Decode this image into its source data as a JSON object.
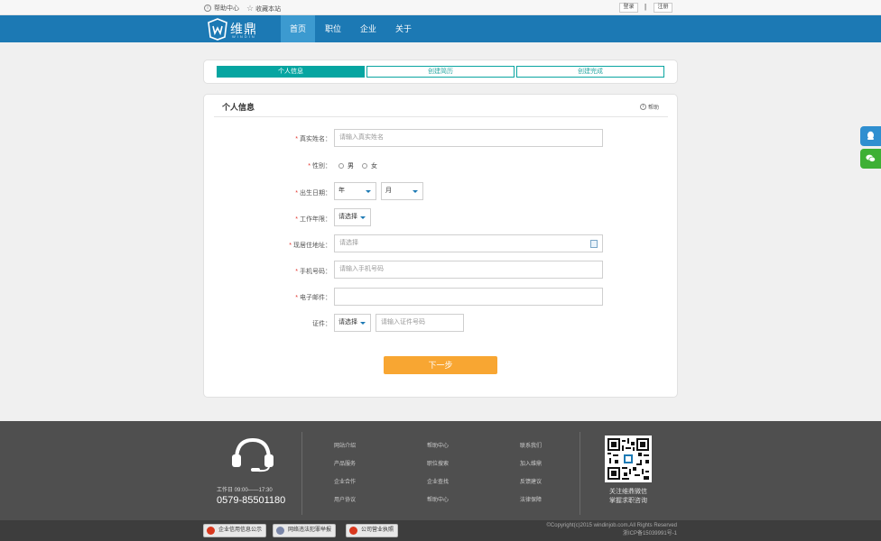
{
  "topbar": {
    "help_center": "帮助中心",
    "bookmark": "收藏本站",
    "login": "登录",
    "separator": "|",
    "register": "注册"
  },
  "nav": {
    "logo_text": "维鼎",
    "logo_sub": "WINDIN",
    "items": [
      "首页",
      "职位",
      "企业",
      "关于"
    ],
    "active_index": 0
  },
  "steps": [
    "个人信息",
    "创建简历",
    "创建完成"
  ],
  "form": {
    "title": "个人信息",
    "help": "帮助",
    "fields": {
      "name": {
        "label": "真实姓名：",
        "placeholder": "请输入真实姓名"
      },
      "gender": {
        "label": "性别：",
        "options": [
          "男",
          "女"
        ]
      },
      "birth": {
        "label": "出生日期：",
        "year": "年",
        "month": "月"
      },
      "work_years": {
        "label": "工作年限：",
        "value": "请选择"
      },
      "address": {
        "label": "现居住地址：",
        "placeholder": "请选择"
      },
      "phone": {
        "label": "手机号码：",
        "placeholder": "请输入手机号码"
      },
      "email": {
        "label": "电子邮件：",
        "placeholder": ""
      },
      "id_doc": {
        "label": "证件：",
        "type_value": "请选择",
        "placeholder": "请输入证件号码"
      }
    },
    "required_mark": "*",
    "next_button": "下一步"
  },
  "footer": {
    "work_time": "工作日  09:00——17:30",
    "phone": "0579-85501180",
    "links": [
      [
        "网站介绍",
        "产品服务",
        "企业合作",
        "用户协议"
      ],
      [
        "帮助中心",
        "职位搜索",
        "企业查找",
        "帮助中心"
      ],
      [
        "联系我们",
        "加入维鼎",
        "反馈建议",
        "法律保障"
      ]
    ],
    "qr_text_1": "关注维鼎微信",
    "qr_text_2": "掌握求职咨询",
    "badges": [
      "企业信用信息公示",
      "网络违法犯罪举报",
      "公司营业执照"
    ],
    "copyright": "©Copyright(c)2015 windinjob.com.All Rights Reserved",
    "icp": "浙ICP备15039991号-1"
  },
  "colors": {
    "nav_blue": "#1c79b4",
    "teal": "#06a5a1",
    "orange": "#f8a632",
    "qq_side": "#2f8fd0",
    "wechat_side": "#3eb035"
  },
  "icons": [
    "info-icon",
    "star-icon",
    "calendar-icon",
    "headset-icon",
    "qr-code",
    "qq-icon",
    "wechat-icon"
  ]
}
